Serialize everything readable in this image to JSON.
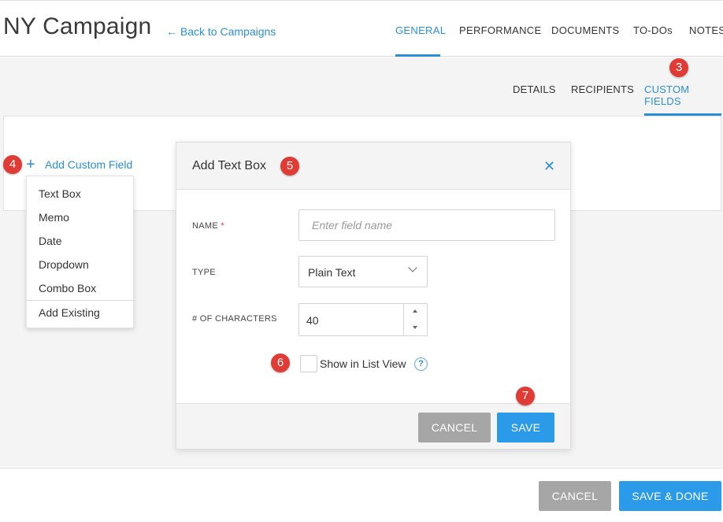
{
  "header": {
    "title": "NY Campaign",
    "back_link": "← Back to Campaigns",
    "tabs": [
      {
        "label": "GENERAL",
        "active": true
      },
      {
        "label": "PERFORMANCE",
        "active": false
      },
      {
        "label": "DOCUMENTS",
        "active": false
      },
      {
        "label": "TO-DOs",
        "active": false
      },
      {
        "label": "NOTES",
        "active": false
      }
    ]
  },
  "sub_tabs": [
    {
      "label": "DETAILS",
      "active": false
    },
    {
      "label": "RECIPIENTS",
      "active": false
    },
    {
      "label": "CUSTOM FIELDS",
      "active": true
    }
  ],
  "badges": [
    "3",
    "4",
    "5",
    "6",
    "7"
  ],
  "add_custom_field": {
    "label": "Add Custom Field",
    "menu_items": [
      "Text Box",
      "Memo",
      "Date",
      "Dropdown",
      "Combo Box"
    ],
    "add_existing": "Add Existing"
  },
  "modal": {
    "title": "Add Text Box",
    "close_symbol": "✕",
    "name_label": "NAME",
    "required_mark": "*",
    "name_placeholder": "Enter field name",
    "type_label": "TYPE",
    "type_value": "Plain Text",
    "chars_label": "# OF CHARACTERS",
    "chars_value": "40",
    "show_in_list_label": "Show in List View",
    "show_in_list_checked": false,
    "help_symbol": "?",
    "cancel_label": "CANCEL",
    "save_label": "SAVE"
  },
  "footer": {
    "cancel_label": "CANCEL",
    "save_done_label": "SAVE & DONE"
  },
  "colors": {
    "accent": "#2b8fd6",
    "badge": "#e03b35",
    "gray_button": "#a6a6a6",
    "blue_button": "#2b9ae8",
    "background": "#f4f4f4"
  }
}
